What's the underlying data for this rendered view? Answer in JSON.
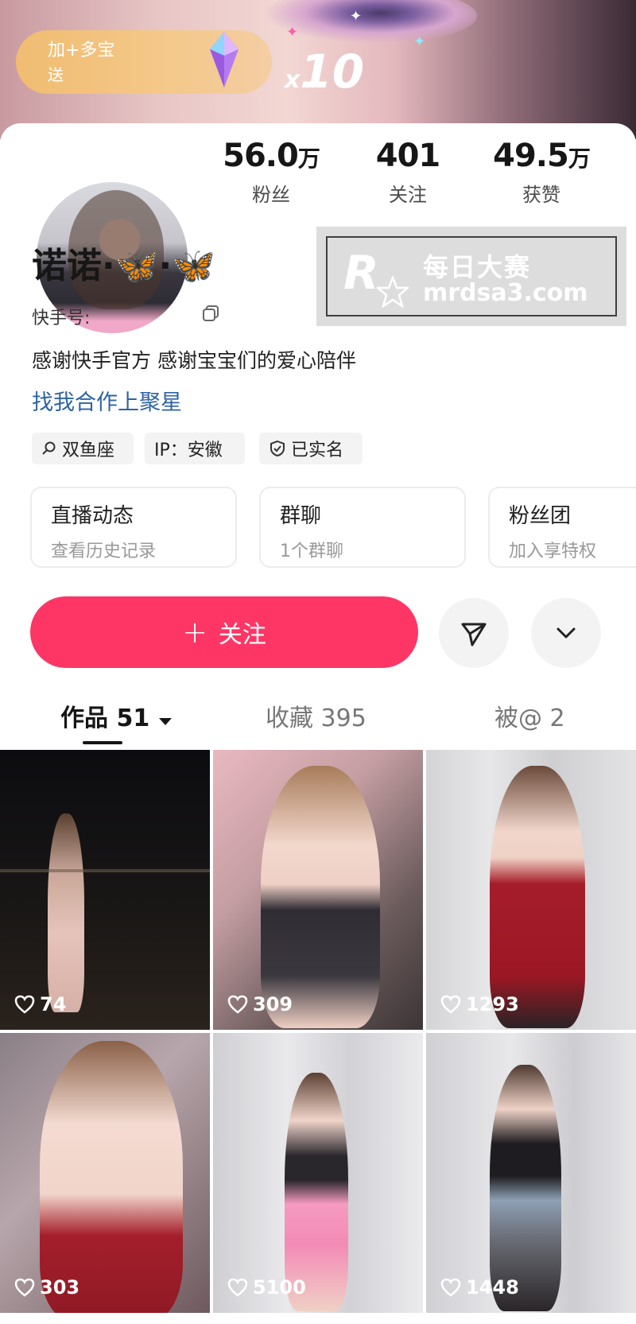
{
  "banner": {
    "gift_title": "加+多宝",
    "gift_sub": "送",
    "multiplier_x": "x",
    "multiplier_n": "10"
  },
  "profile": {
    "name_prefix": "诺诺·",
    "name_bfly": "🦋",
    "name_mid": "·",
    "kuaishou_label": "快手号:",
    "bio": "感谢快手官方 感谢宝宝们的爱心陪伴",
    "collab_link": "找我合作上聚星"
  },
  "stats": [
    {
      "num": "56.0",
      "unit": "万",
      "label": "粉丝"
    },
    {
      "num": "401",
      "unit": "",
      "label": "关注"
    },
    {
      "num": "49.5",
      "unit": "万",
      "label": "获赞"
    }
  ],
  "tags": [
    {
      "label": "双鱼座"
    },
    {
      "label": "IP：安徽"
    },
    {
      "label": "已实名"
    }
  ],
  "features": [
    {
      "title": "直播动态",
      "sub": "查看历史记录"
    },
    {
      "title": "群聊",
      "sub": "1个群聊"
    },
    {
      "title": "粉丝团",
      "sub": "加入享特权"
    }
  ],
  "actions": {
    "follow_label": "关注",
    "follow_plus": "+"
  },
  "tabs": [
    {
      "label": "作品 51"
    },
    {
      "label": "收藏 395"
    },
    {
      "label": "被@ 2"
    }
  ],
  "videos": [
    {
      "likes": "74"
    },
    {
      "likes": "309"
    },
    {
      "likes": "1293"
    },
    {
      "likes": "303"
    },
    {
      "likes": "5100"
    },
    {
      "likes": "1448"
    }
  ],
  "watermark": {
    "logo": "R",
    "title": "每日大赛",
    "url": "mrdsa3.com"
  },
  "colors": {
    "accent": "#fe3666",
    "link": "#2e63a6"
  }
}
